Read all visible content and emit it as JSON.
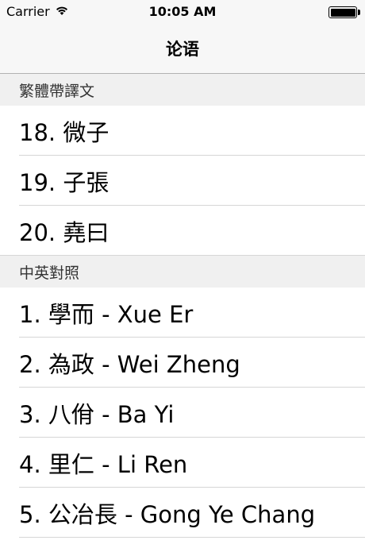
{
  "status_bar": {
    "carrier": "Carrier",
    "time": "10:05 AM"
  },
  "nav": {
    "title": "论语"
  },
  "sections": [
    {
      "header": "繁體帶譯文",
      "rows": [
        "18. 微子",
        "19. 子張",
        "20. 堯曰"
      ]
    },
    {
      "header": "中英對照",
      "rows": [
        "1. 學而 - Xue Er",
        "2. 為政 - Wei Zheng",
        "3. 八佾 - Ba Yi",
        "4. 里仁 - Li Ren",
        "5. 公冶長 - Gong Ye Chang"
      ]
    }
  ]
}
